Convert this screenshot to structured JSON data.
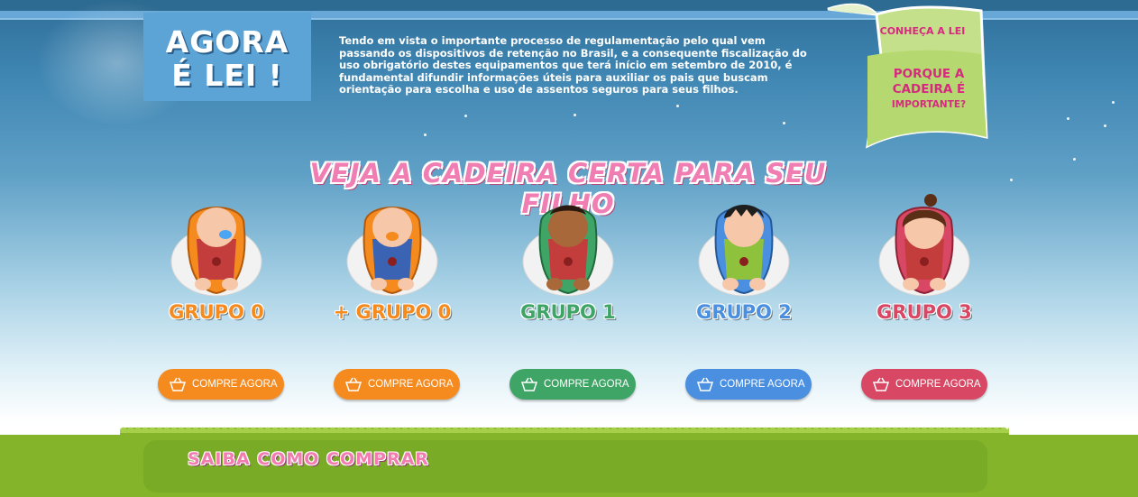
{
  "law": {
    "title_line1": "AGORA",
    "title_line2": "É LEI !",
    "text": "Tendo em vista o importante processo de regulamentação pelo qual vem passando os dispositivos de retenção no Brasil, e a consequente fiscalização do uso obrigatório destes equipamentos que terá início em setembro de 2010, é fundamental difundir informações úteis para auxiliar os pais que buscam orientação para escolha e uso de assentos seguros para seus filhos."
  },
  "ribbon": {
    "know_law": "CONHEÇA A LEI",
    "why_line1": "PORQUE A",
    "why_line2": "CADEIRA É",
    "why_line3": "IMPORTANTE?"
  },
  "headline": "VEJA A CADEIRA CERTA PARA SEU FILHO",
  "groups": [
    {
      "label": "GRUPO 0",
      "color": "#f58a1f",
      "button": "COMPRE AGORA"
    },
    {
      "label": "+ GRUPO 0",
      "color": "#f58a1f",
      "button": "COMPRE AGORA"
    },
    {
      "label": "GRUPO 1",
      "color": "#3fa566",
      "button": "COMPRE AGORA"
    },
    {
      "label": "GRUPO 2",
      "color": "#4a8fe0",
      "button": "COMPRE AGORA"
    },
    {
      "label": "GRUPO 3",
      "color": "#d84764",
      "button": "COMPRE AGORA"
    }
  ],
  "footer": {
    "how_to_buy": "SAIBA COMO COMPRAR"
  },
  "icons": {
    "basket": "basket-icon",
    "child_seat": "child-seat-icon"
  }
}
